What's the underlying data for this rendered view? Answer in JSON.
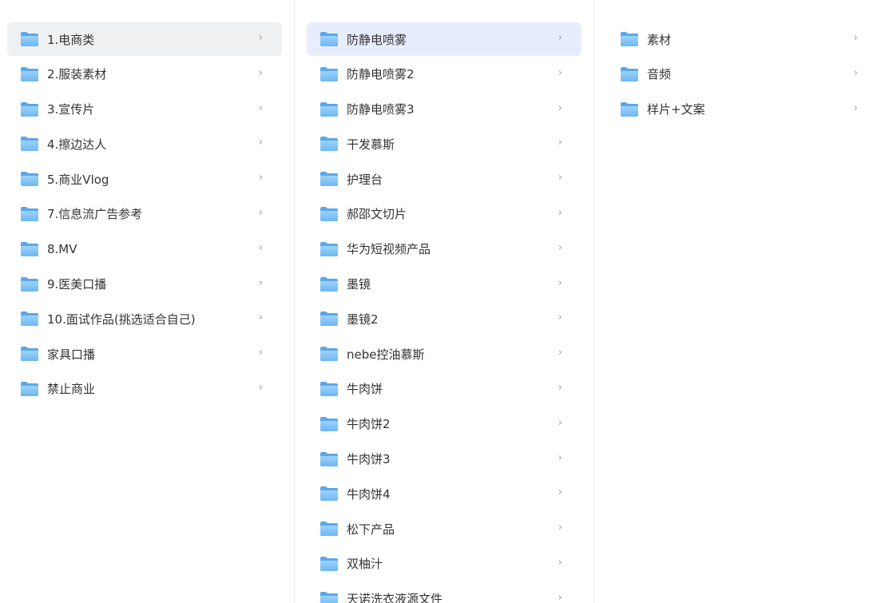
{
  "colors": {
    "selected_gray": "#eff0f2",
    "selected_blue": "#e8edfd",
    "folder_blue": "#6db7f2",
    "text": "#333333",
    "chevron": "#9aa0a6"
  },
  "icons": {
    "folder": "folder-icon",
    "chevron": "chevron-right-icon"
  },
  "column1": {
    "items": [
      {
        "label": "1.电商类",
        "chevron": "›"
      },
      {
        "label": "2.服装素材",
        "chevron": "›"
      },
      {
        "label": "3.宣传片",
        "chevron": "›"
      },
      {
        "label": "4.擦边达人",
        "chevron": "›"
      },
      {
        "label": "5.商业Vlog",
        "chevron": "›"
      },
      {
        "label": "7.信息流广告参考",
        "chevron": "›"
      },
      {
        "label": "8.MV",
        "chevron": "›"
      },
      {
        "label": "9.医美口播",
        "chevron": "›"
      },
      {
        "label": "10.面试作品(挑选适合自己)",
        "chevron": "›"
      },
      {
        "label": "家具口播",
        "chevron": "›"
      },
      {
        "label": "禁止商业",
        "chevron": "›"
      }
    ]
  },
  "column2": {
    "items": [
      {
        "label": "防静电喷雾",
        "chevron": "›"
      },
      {
        "label": "防静电喷雾2",
        "chevron": "›"
      },
      {
        "label": "防静电喷雾3",
        "chevron": "›"
      },
      {
        "label": "干发慕斯",
        "chevron": "›"
      },
      {
        "label": "护理台",
        "chevron": "›"
      },
      {
        "label": "郝邵文切片",
        "chevron": "›"
      },
      {
        "label": "华为短视频产品",
        "chevron": "›"
      },
      {
        "label": "墨镜",
        "chevron": "›"
      },
      {
        "label": "墨镜2",
        "chevron": "›"
      },
      {
        "label": "nebe控油慕斯",
        "chevron": "›"
      },
      {
        "label": "牛肉饼",
        "chevron": "›"
      },
      {
        "label": "牛肉饼2",
        "chevron": "›"
      },
      {
        "label": "牛肉饼3",
        "chevron": "›"
      },
      {
        "label": "牛肉饼4",
        "chevron": "›"
      },
      {
        "label": "松下产品",
        "chevron": "›"
      },
      {
        "label": "双柚汁",
        "chevron": "›"
      },
      {
        "label": "天诺洗衣液源文件",
        "chevron": "›"
      }
    ]
  },
  "column3": {
    "items": [
      {
        "label": "素材",
        "chevron": "›"
      },
      {
        "label": "音频",
        "chevron": "›"
      },
      {
        "label": "样片+文案",
        "chevron": "›"
      }
    ]
  }
}
